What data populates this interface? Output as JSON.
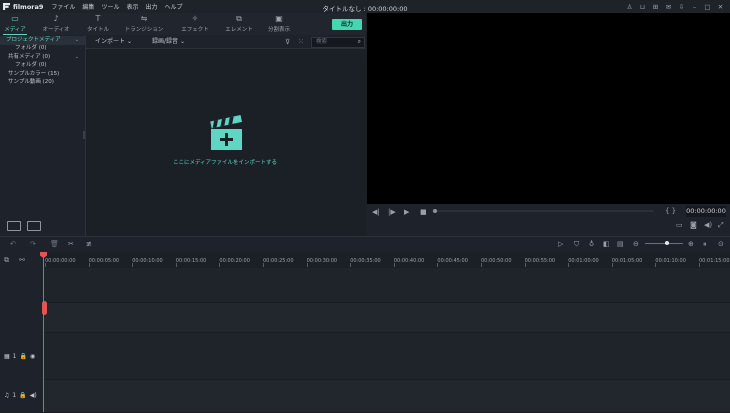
{
  "app": {
    "logo_text": "filmora9",
    "document_title": "タイトルなし : 00:00:00:00"
  },
  "menu": [
    "ファイル",
    "編集",
    "ツール",
    "表示",
    "出力",
    "ヘルプ"
  ],
  "window_icons": [
    "user-icon",
    "cart-icon",
    "gift-icon",
    "mail-icon",
    "download-icon",
    "minimize-icon",
    "maximize-icon",
    "close-icon"
  ],
  "toolbar": {
    "tabs": [
      {
        "label": "メディア",
        "icon": "folder-icon",
        "active": true
      },
      {
        "label": "オーディオ",
        "icon": "music-note-icon"
      },
      {
        "label": "タイトル",
        "icon": "text-icon"
      },
      {
        "label": "トランジション",
        "icon": "transition-icon"
      },
      {
        "label": "エフェクト",
        "icon": "effects-icon"
      },
      {
        "label": "エレメント",
        "icon": "element-icon"
      },
      {
        "label": "分割表示",
        "icon": "split-screen-icon"
      }
    ],
    "export_label": "出力"
  },
  "library": {
    "items": [
      {
        "label": "プロジェクトメディア",
        "arrow": "⌄"
      },
      {
        "label": "フォルダ (0)"
      },
      {
        "label": "共有メディア (0)",
        "arrow": "⌄"
      },
      {
        "label": "フォルダ (0)"
      },
      {
        "label": "サンプルカラー (15)"
      },
      {
        "label": "サンプル動画 (20)"
      }
    ]
  },
  "media": {
    "import_label": "インポート",
    "record_label": "録画/録音",
    "search_placeholder": "検索",
    "empty_hint": "ここにメディアファイルをインポートする"
  },
  "preview": {
    "timecode": "00:00:00:00"
  },
  "timeline": {
    "ruler": [
      "00:00:00:00",
      "00:00:05:00",
      "00:00:10:00",
      "00:00:15:00",
      "00:00:20:00",
      "00:00:25:00",
      "00:00:30:00",
      "00:00:35:00",
      "00:00:40:00",
      "00:00:45:00",
      "00:00:50:00",
      "00:00:55:00",
      "00:01:00:00",
      "00:01:05:00",
      "00:01:10:00",
      "00:01:15:00"
    ],
    "video_track_label": "1",
    "audio_track_label": "1"
  }
}
